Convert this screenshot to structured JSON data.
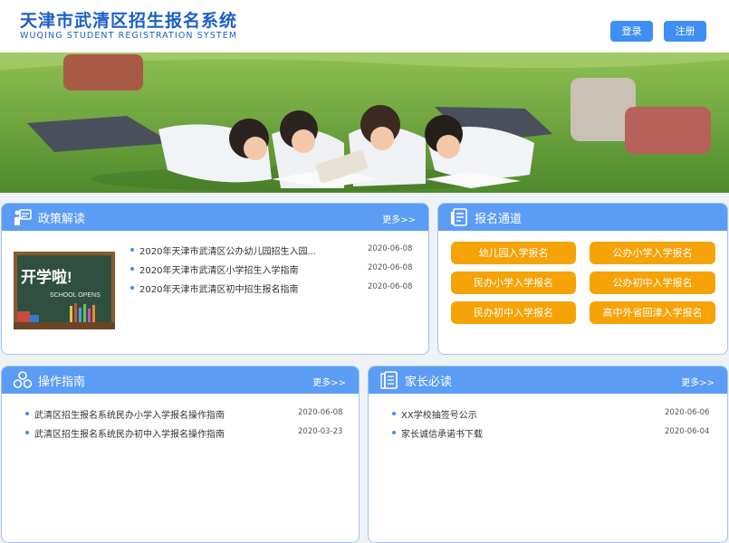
{
  "header": {
    "title_cn": "天津市武清区招生报名系统",
    "title_en": "WUQING STUDENT REGISTRATION SYSTEM",
    "login_label": "登录",
    "register_label": "注册"
  },
  "colors": {
    "primary": "#3f8ef4",
    "panel_header": "#5b9cf5",
    "brand_text": "#1a5fc8",
    "orange_button": "#f5a307"
  },
  "policy": {
    "title": "政策解读",
    "more": "更多>>",
    "icon": "presenter-icon",
    "image_text": "开学啦!",
    "image_subtext": "SCHOOL OPENS",
    "items": [
      {
        "title": "2020年天津市武清区公办幼儿园招生入园...",
        "date": "2020-06-08"
      },
      {
        "title": "2020年天津市武清区小学招生入学指南",
        "date": "2020-06-08"
      },
      {
        "title": "2020年天津市武清区初中招生报名指南",
        "date": "2020-06-08"
      }
    ]
  },
  "registration": {
    "title": "报名通道",
    "icon": "document-list-icon",
    "buttons": [
      {
        "label": "幼儿园入学报名"
      },
      {
        "label": "公办小学入学报名"
      },
      {
        "label": "民办小学入学报名"
      },
      {
        "label": "公办初中入学报名"
      },
      {
        "label": "民办初中入学报名"
      },
      {
        "label": "高中外省回津入学报名"
      }
    ]
  },
  "guide": {
    "title": "操作指南",
    "more": "更多>>",
    "icon": "cluster-icon",
    "items": [
      {
        "title": "武清区招生报名系统民办小学入学报名操作指南",
        "date": "2020-06-08"
      },
      {
        "title": "武清区招生报名系统民办初中入学报名操作指南",
        "date": "2020-03-23"
      }
    ]
  },
  "parents": {
    "title": "家长必读",
    "more": "更多>>",
    "icon": "book-list-icon",
    "items": [
      {
        "title": "XX学校抽签号公示",
        "date": "2020-06-06"
      },
      {
        "title": "家长诚信承诺书下载",
        "date": "2020-06-04"
      }
    ]
  }
}
